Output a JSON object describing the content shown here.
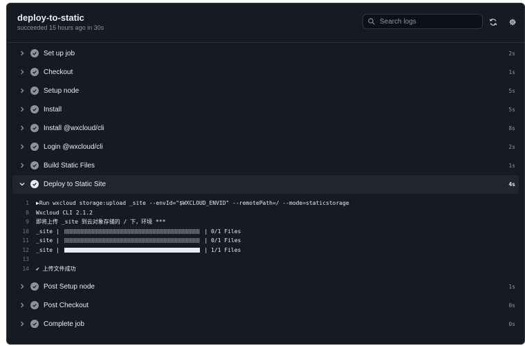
{
  "header": {
    "title": "deploy-to-static",
    "subtitle": "succeeded 15 hours ago in 30s",
    "search_placeholder": "Search logs"
  },
  "steps_before": [
    {
      "name": "Set up job",
      "duration": "2s"
    },
    {
      "name": "Checkout",
      "duration": "1s"
    },
    {
      "name": "Setup node",
      "duration": "5s"
    },
    {
      "name": "Install",
      "duration": "5s"
    },
    {
      "name": "Install @wxcloud/cli",
      "duration": "8s"
    },
    {
      "name": "Login @wxcloud/cli",
      "duration": "2s"
    },
    {
      "name": "Build Static Files",
      "duration": "1s"
    }
  ],
  "expanded_step": {
    "name": "Deploy to Static Site",
    "duration": "4s"
  },
  "log": [
    {
      "n": "1",
      "text": "▶Run wxcloud storage:upload _site --envId=\"$WXCLOUD_ENVID\" --remotePath=/ --mode=staticstorage"
    },
    {
      "n": "8",
      "text": "Wxcloud CLI 2.1.2"
    },
    {
      "n": "9",
      "text": "即将上传 _site 到云对象存储的 / 下，环境 ***"
    },
    {
      "n": "10",
      "prefix": "_site | ",
      "bar": "empty",
      "suffix": " | 0/1 Files"
    },
    {
      "n": "11",
      "prefix": "_site | ",
      "bar": "empty",
      "suffix": " | 0/1 Files"
    },
    {
      "n": "12",
      "prefix": "_site | ",
      "bar": "full",
      "suffix": " | 1/1 Files"
    },
    {
      "n": "13",
      "text": ""
    },
    {
      "n": "14",
      "text": "✔ 上传文件成功"
    }
  ],
  "steps_after": [
    {
      "name": "Post Setup node",
      "duration": "1s"
    },
    {
      "name": "Post Checkout",
      "duration": "0s"
    },
    {
      "name": "Complete job",
      "duration": "0s"
    }
  ]
}
